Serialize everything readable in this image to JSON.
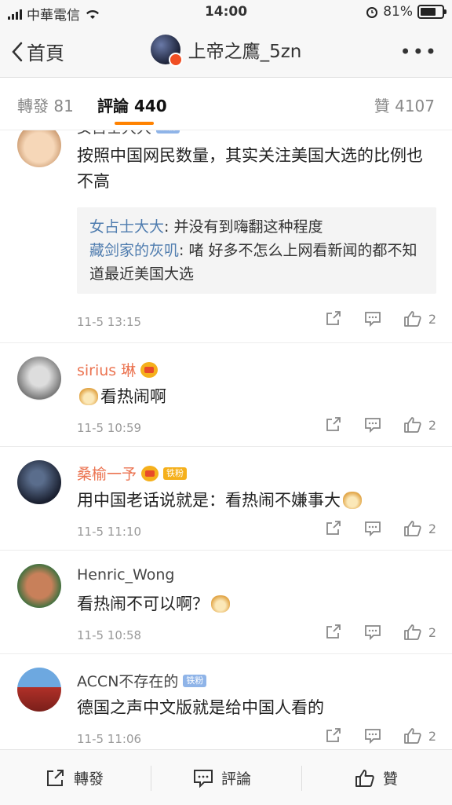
{
  "status_bar": {
    "carrier": "中華電信",
    "time": "14:00",
    "battery": "81%"
  },
  "nav": {
    "back_label": "首頁",
    "title": "上帝之鷹_5zn",
    "more": "•••"
  },
  "tabs": [
    {
      "label": "轉發 81"
    },
    {
      "label": "評論 440"
    },
    {
      "label": "贊 4107"
    }
  ],
  "comments": [
    {
      "name": "女占士大大",
      "badge": "铁粉",
      "text": "按照中国网民数量，其实关注美国大选的比例也不高",
      "replies": [
        {
          "name": "女占士大大",
          "text": ": 并没有到嗨翻这种程度"
        },
        {
          "name": "藏剑家的灰叽",
          "text": ": 啫 好多不怎么上网看新闻的都不知道最近美国大选"
        }
      ],
      "time": "11-5 13:15",
      "likes": "2"
    },
    {
      "name": "sirius 琳",
      "text": "看热闹啊",
      "time": "11-5 10:59",
      "likes": "2"
    },
    {
      "name": "桑榆一予",
      "badge": "铁粉",
      "text": "用中国老话说就是：看热闹不嫌事大",
      "time": "11-5 11:10",
      "likes": "2"
    },
    {
      "name": "Henric_Wong",
      "text": "看热闹不可以啊？",
      "time": "11-5 10:58",
      "likes": "2"
    },
    {
      "name": "ACCN不存在的",
      "badge": "铁粉",
      "text": "德国之声中文版就是给中国人看的",
      "time": "11-5 11:06",
      "likes": "2"
    }
  ],
  "bottom_bar": {
    "repost": "轉發",
    "comment": "評論",
    "like": "贊"
  },
  "colors": {
    "accent": "#ff8200",
    "reply_name": "#507daf",
    "vip_name": "#eb7350"
  }
}
